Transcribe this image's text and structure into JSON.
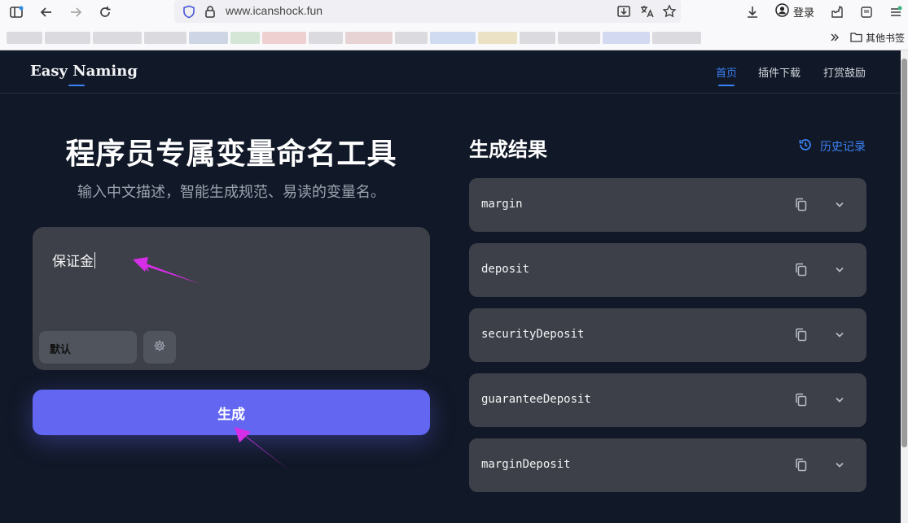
{
  "browser": {
    "url": "www.icanshock.fun",
    "login_label": "登录",
    "other_bookmarks": "其他书签"
  },
  "nav": {
    "brand": "Easy Naming",
    "links": [
      "首页",
      "插件下载",
      "打赏鼓励"
    ]
  },
  "hero": {
    "title": "程序员专属变量命名工具",
    "subtitle": "输入中文描述，智能生成规范、易读的变量名。"
  },
  "input": {
    "value": "保证金",
    "style_option": "默认"
  },
  "generate_label": "生成",
  "results": {
    "title": "生成结果",
    "history_label": "历史记录",
    "items": [
      "margin",
      "deposit",
      "securityDeposit",
      "guaranteeDeposit",
      "marginDeposit"
    ]
  },
  "colors": {
    "accent": "#3b82f6",
    "button": "#6366f1",
    "background": "#111827",
    "card": "#3d4048",
    "annotation_arrow": "#d62ee6"
  }
}
